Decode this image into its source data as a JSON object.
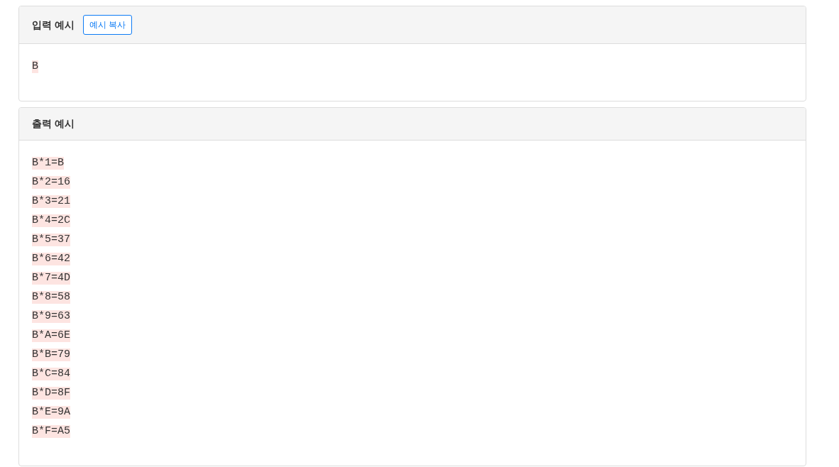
{
  "sections": [
    {
      "title": "입력 예시",
      "button": "예시 복사",
      "lines": [
        "B"
      ]
    },
    {
      "title": "출력 예시",
      "lines": [
        "B*1=B",
        "B*2=16",
        "B*3=21",
        "B*4=2C",
        "B*5=37",
        "B*6=42",
        "B*7=4D",
        "B*8=58",
        "B*9=63",
        "B*A=6E",
        "B*B=79",
        "B*C=84",
        "B*D=8F",
        "B*E=9A",
        "B*F=A5"
      ]
    }
  ]
}
